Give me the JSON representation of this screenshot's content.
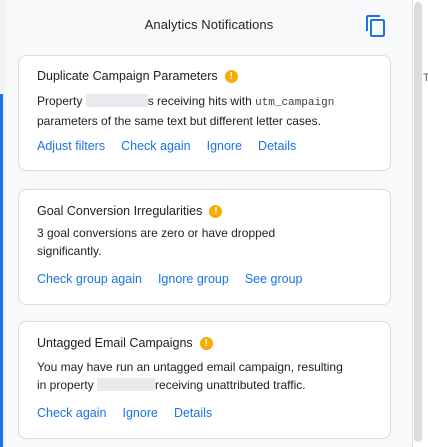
{
  "panel": {
    "title": "Analytics Notifications",
    "copy_icon": "copy-icon"
  },
  "background": {
    "peek_text": "T"
  },
  "cards": [
    {
      "title": "Duplicate Campaign Parameters",
      "icon": "warning-icon",
      "body": {
        "prefix": "Property",
        "after_redaction": "s receiving hits with",
        "code": "utm_campaign",
        "line2": "parameters of the same text but different letter cases."
      },
      "actions": [
        "Adjust filters",
        "Check again",
        "Ignore",
        "Details"
      ]
    },
    {
      "title": "Goal Conversion Irregularities",
      "icon": "warning-icon",
      "body": {
        "text": "3 goal conversions are zero or have dropped significantly."
      },
      "actions": [
        "Check group again",
        "Ignore group",
        "See group"
      ]
    },
    {
      "title": "Untagged Email Campaigns",
      "icon": "warning-icon",
      "body": {
        "line1": "You may have run an untagged email campaign, resulting",
        "line2_prefix": "in property",
        "line2_suffix": "receiving unattributed traffic."
      },
      "actions": [
        "Check again",
        "Ignore",
        "Details"
      ]
    }
  ],
  "colors": {
    "link": "#1a73e8",
    "warning": "#f9ab00",
    "panel_bg": "#f8f9fa",
    "card_border": "#dadce0"
  }
}
